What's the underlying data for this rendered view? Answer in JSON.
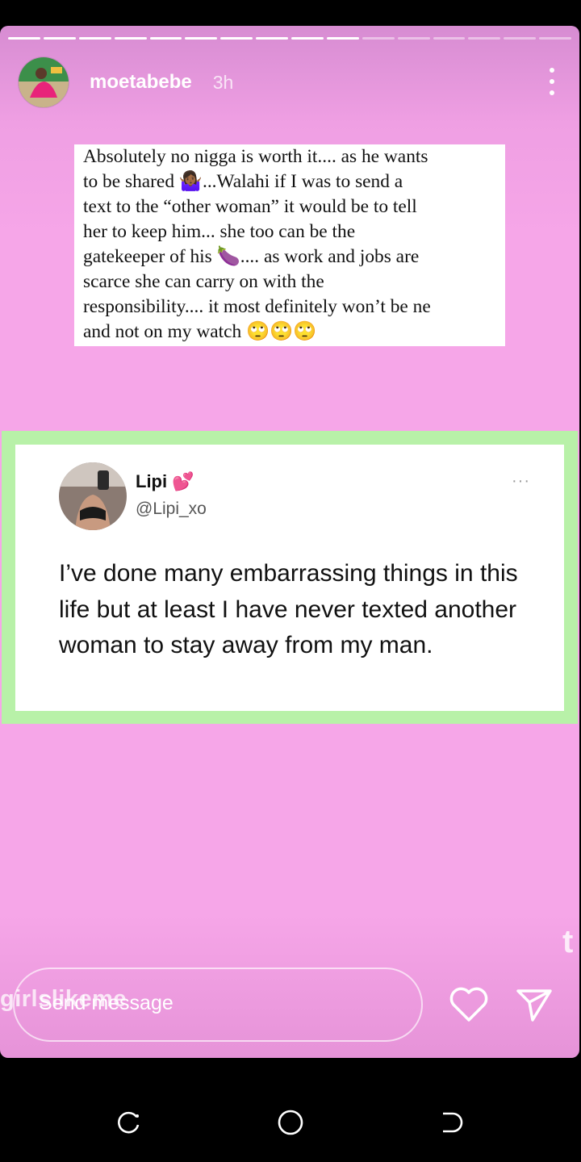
{
  "story": {
    "progress_total": 16,
    "progress_done": 10,
    "username": "moetabebe",
    "time": "3h",
    "caption_lines": [
      "Absolutely no nigga is worth it.... as he wants",
      "to be shared 🤷🏾‍♀️...Walahi if I was to send a",
      "text to the “other woman” it would be to tell",
      "her to keep him... she too can be the",
      "gatekeeper of his 🍆.... as work and jobs are",
      "scarce she can carry on with the",
      "responsibility.... it most definitely won’t be ne",
      "and not on my watch 🙄🙄🙄"
    ]
  },
  "tweet": {
    "name": "Lipi",
    "name_emoji": "💕",
    "handle": "@Lipi_xo",
    "more": "···",
    "text": "I’ve done many embarrassing things in this life but at least I have never texted another woman to stay away from my man."
  },
  "reply": {
    "placeholder": "Send message",
    "watermark": "girlslikeme",
    "side_mark": "t"
  },
  "icons": {
    "menu": "more-vertical-icon",
    "heart": "heart-icon",
    "send": "send-icon",
    "nav_recent": "recent-apps-icon",
    "nav_home": "home-icon",
    "nav_back": "back-icon"
  },
  "colors": {
    "story_bg": "#f6a6e8",
    "tweet_frame": "#b8f1a8",
    "text_white": "#ffffff"
  }
}
